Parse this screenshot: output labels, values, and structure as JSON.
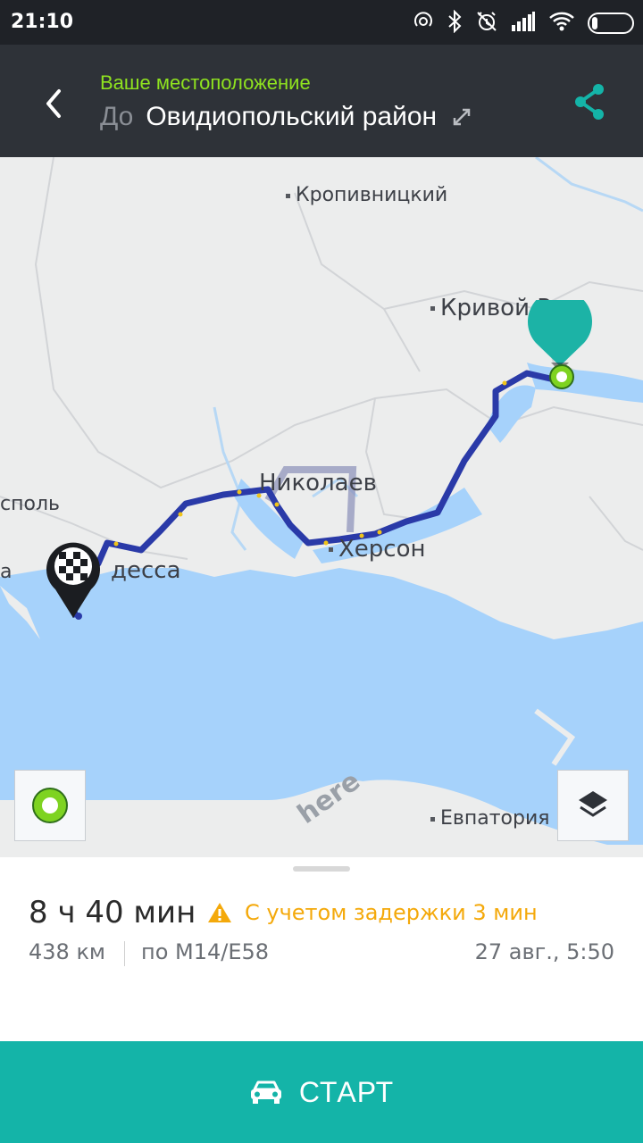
{
  "status_bar": {
    "time": "21:10",
    "icons": [
      "hotspot-icon",
      "bluetooth-icon",
      "alarm-off-icon",
      "signal-icon",
      "wifi-icon",
      "battery-icon"
    ]
  },
  "header": {
    "from_label": "Ваше местоположение",
    "to_prefix": "До",
    "destination": "Овидиопольский район",
    "colors": {
      "from": "#8fe31f",
      "accent": "#14b4a8",
      "background": "#2e3238"
    }
  },
  "map": {
    "cities": [
      {
        "name": "Кропивницкий"
      },
      {
        "name": "Кривой Р"
      },
      {
        "name": "Николаев"
      },
      {
        "name": "Херсон"
      },
      {
        "name": "Одесса",
        "display": "десса"
      },
      {
        "name": "Евпатория"
      },
      {
        "name": "Тирасполь",
        "display": "споль"
      },
      {
        "name": "а"
      }
    ],
    "watermark": "here",
    "route_color": "#2a3aa8",
    "water_color": "#a6d2fb"
  },
  "route_summary": {
    "duration": "8 ч 40 мин",
    "delay_warning": "С учетом задержки 3 мин",
    "distance": "438 км",
    "road": "по М14/Е58",
    "arrival": "27 авг., 5:50"
  },
  "actions": {
    "start_label": "СТАРТ"
  }
}
